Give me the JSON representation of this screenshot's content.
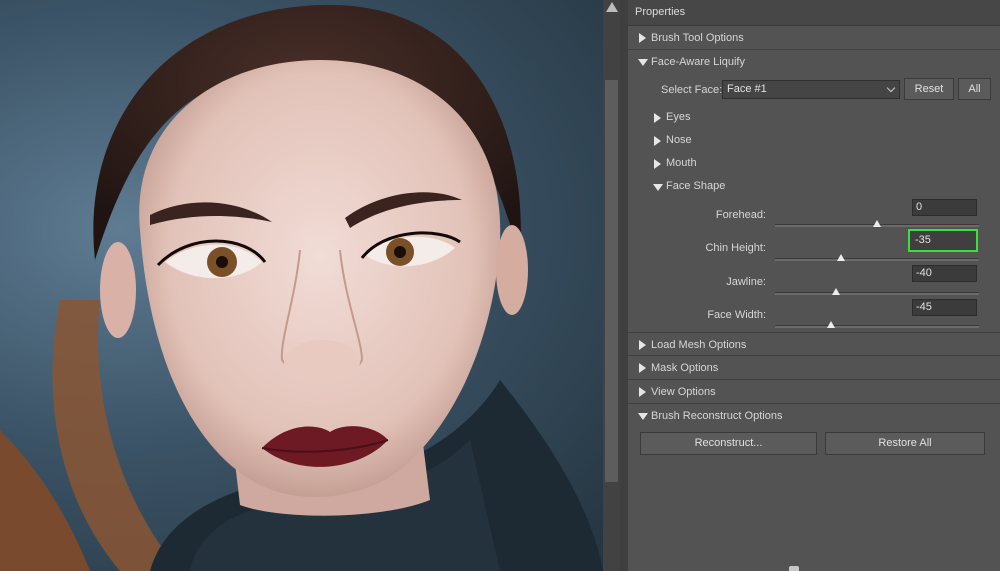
{
  "panel": {
    "title": "Properties"
  },
  "sections": {
    "brush_tool_options": "Brush Tool Options",
    "face_aware_liquify": "Face-Aware Liquify",
    "load_mesh_options": "Load Mesh Options",
    "mask_options": "Mask Options",
    "view_options": "View Options",
    "brush_reconstruct_options": "Brush Reconstruct Options"
  },
  "face_select": {
    "label": "Select Face:",
    "value": "Face #1",
    "reset_label": "Reset",
    "all_label": "All"
  },
  "subsections": {
    "eyes": "Eyes",
    "nose": "Nose",
    "mouth": "Mouth",
    "face_shape": "Face Shape"
  },
  "face_shape": {
    "range": [
      -100,
      100
    ],
    "sliders": [
      {
        "label": "Forehead:",
        "value": "0",
        "numeric": 0
      },
      {
        "label": "Chin Height:",
        "value": "-35",
        "numeric": -35,
        "highlighted": true,
        "highlight_color": "#39e23a"
      },
      {
        "label": "Jawline:",
        "value": "-40",
        "numeric": -40
      },
      {
        "label": "Face Width:",
        "value": "-45",
        "numeric": -45
      }
    ]
  },
  "reconstruct": {
    "reconstruct_label": "Reconstruct...",
    "restore_all_label": "Restore All"
  }
}
